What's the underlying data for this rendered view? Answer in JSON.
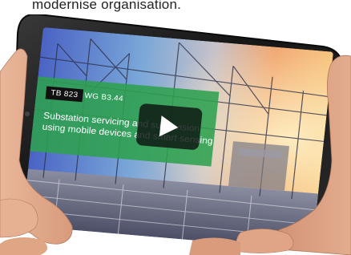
{
  "caption": {
    "text": "modernise organisation."
  },
  "video": {
    "badge_primary": "TB 823",
    "badge_secondary": "WG B3.44",
    "title": "Substation servicing and supervision using mobile devices and smart sensing",
    "play_icon": "play-icon"
  },
  "colors": {
    "panel_green": "#2ea04e",
    "badge_black": "#111111",
    "phone_body": "#1a1a1a",
    "play_button": "#0c1410"
  }
}
